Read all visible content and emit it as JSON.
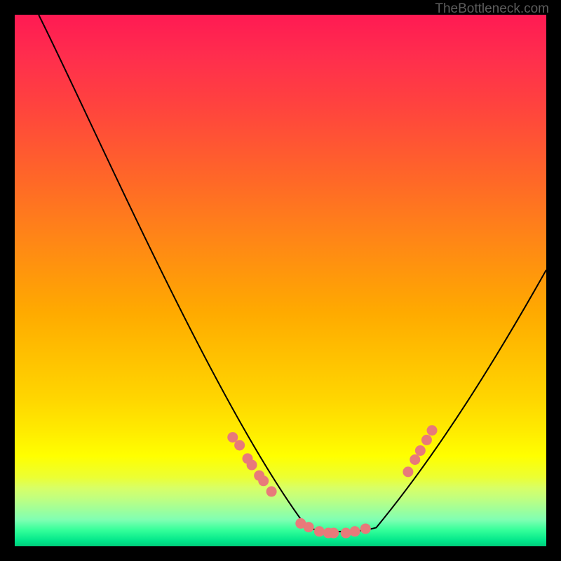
{
  "watermark": "TheBottleneck.com",
  "chart_data": {
    "type": "line",
    "title": "",
    "xlabel": "",
    "ylabel": "",
    "xlim": [
      0,
      100
    ],
    "ylim": [
      0,
      100
    ],
    "curve": {
      "description": "V-shaped bottleneck curve starting top-left, descending to trough, rising right",
      "start_x": 4.5,
      "start_y": 100,
      "trough_x_start": 55,
      "trough_x_end": 68,
      "trough_y": 2.5,
      "end_x": 100,
      "end_y": 52
    },
    "dots": {
      "left_cluster": [
        {
          "x": 41,
          "y": 20.5
        },
        {
          "x": 42.3,
          "y": 19
        },
        {
          "x": 43.8,
          "y": 16.5
        },
        {
          "x": 44.6,
          "y": 15.3
        },
        {
          "x": 46,
          "y": 13.3
        },
        {
          "x": 46.8,
          "y": 12.3
        },
        {
          "x": 48.3,
          "y": 10.3
        }
      ],
      "bottom_cluster": [
        {
          "x": 53.8,
          "y": 4.3
        },
        {
          "x": 55.3,
          "y": 3.6
        },
        {
          "x": 57.3,
          "y": 2.8
        },
        {
          "x": 59,
          "y": 2.5
        },
        {
          "x": 60,
          "y": 2.5
        },
        {
          "x": 62.3,
          "y": 2.5
        },
        {
          "x": 64,
          "y": 2.8
        },
        {
          "x": 66,
          "y": 3.3
        }
      ],
      "right_cluster": [
        {
          "x": 74,
          "y": 14
        },
        {
          "x": 75.3,
          "y": 16.3
        },
        {
          "x": 76.3,
          "y": 18
        },
        {
          "x": 77.5,
          "y": 20
        },
        {
          "x": 78.5,
          "y": 21.8
        }
      ]
    },
    "colors": {
      "dot_fill": "#e87a7a",
      "curve": "#000000"
    }
  }
}
